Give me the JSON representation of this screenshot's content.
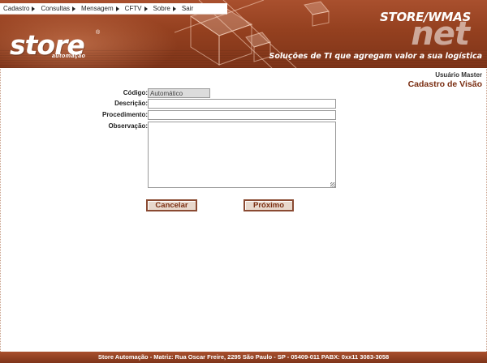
{
  "menu": [
    {
      "label": "Cadastro",
      "has_submenu": true
    },
    {
      "label": "Consultas",
      "has_submenu": true
    },
    {
      "label": "Mensagem",
      "has_submenu": true
    },
    {
      "label": "CFTV",
      "has_submenu": true
    },
    {
      "label": "Sobre",
      "has_submenu": true
    },
    {
      "label": "Sair",
      "has_submenu": false
    }
  ],
  "header": {
    "logo_text": "store",
    "logo_reg": "®",
    "logo_sub": "automação",
    "brand_top": "STORE/WMAS",
    "brand_net": "net",
    "tagline": "Soluções de TI que agregam valor a sua logística"
  },
  "user": {
    "label": "Usuário Master"
  },
  "page": {
    "title": "Cadastro de Visão"
  },
  "form": {
    "codigo": {
      "label": "Código:",
      "value": "Automático"
    },
    "descricao": {
      "label": "Descrição:",
      "value": ""
    },
    "procedimento": {
      "label": "Procedimento:",
      "value": ""
    },
    "observacao": {
      "label": "Observação:",
      "value": ""
    }
  },
  "buttons": {
    "cancel": "Cancelar",
    "next": "Próximo"
  },
  "footer": {
    "text": "Store Automação - Matriz: Rua Oscar Freire, 2295 São Paulo - SP - 05409-011 PABX: 0xx11 3083-3058"
  },
  "colors": {
    "brand": "#94401f",
    "title": "#7a2e12",
    "button_bg": "#e8d8cc"
  }
}
